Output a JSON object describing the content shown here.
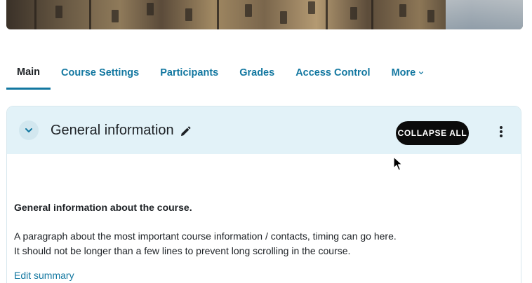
{
  "tabs": [
    {
      "label": "Main",
      "active": true
    },
    {
      "label": "Course Settings",
      "active": false
    },
    {
      "label": "Participants",
      "active": false
    },
    {
      "label": "Grades",
      "active": false
    },
    {
      "label": "Access Control",
      "active": false
    },
    {
      "label": "More",
      "active": false
    }
  ],
  "section": {
    "title": "General information",
    "collapse_all_label": "COLLAPSE ALL",
    "summary_heading": "General information about the course.",
    "summary_lines": [
      "A paragraph about the most important course information / contacts, timing can go here.",
      "It should not be longer than a few lines to prevent long scrolling in the course."
    ],
    "edit_summary_label": "Edit summary"
  },
  "colors": {
    "accent": "#1277a0",
    "header_bg": "#e2f2f8",
    "button_bg": "#0b0b0b"
  },
  "icons": {
    "toggle": "chevron-down-icon",
    "edit": "pencil-icon",
    "menu": "kebab-menu-icon",
    "more_dropdown": "chevron-down-icon"
  }
}
